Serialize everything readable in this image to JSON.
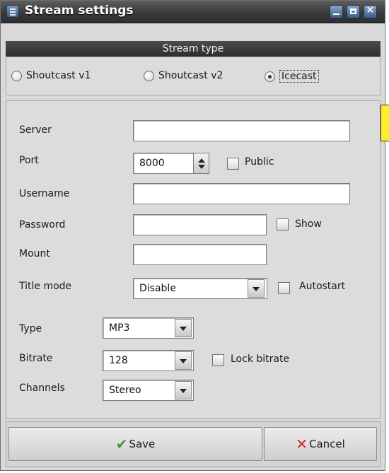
{
  "window": {
    "title": "Stream settings"
  },
  "stream_type": {
    "header": "Stream type",
    "options": [
      {
        "label": "Shoutcast v1",
        "selected": false
      },
      {
        "label": "Shoutcast v2",
        "selected": false
      },
      {
        "label": "Icecast",
        "selected": true
      }
    ]
  },
  "form": {
    "server": {
      "label": "Server",
      "value": ""
    },
    "port": {
      "label": "Port",
      "value": "8000",
      "public_label": "Public",
      "public_checked": false
    },
    "username": {
      "label": "Username",
      "value": ""
    },
    "password": {
      "label": "Password",
      "value": "",
      "show_label": "Show",
      "show_checked": false
    },
    "mount": {
      "label": "Mount",
      "value": ""
    },
    "title_mode": {
      "label": "Title mode",
      "value": "Disable",
      "autostart_label": "Autostart",
      "autostart_checked": false
    },
    "type": {
      "label": "Type",
      "value": "MP3"
    },
    "bitrate": {
      "label": "Bitrate",
      "value": "128",
      "lock_label": "Lock bitrate",
      "lock_checked": false
    },
    "channels": {
      "label": "Channels",
      "value": "Stereo"
    }
  },
  "buttons": {
    "save": "Save",
    "cancel": "Cancel"
  },
  "icons": {
    "app": "window-menu-icon",
    "minimize": "minimize-icon",
    "maximize": "maximize-icon",
    "close": "close-icon",
    "save": "checkmark-icon",
    "cancel": "cross-icon"
  },
  "colors": {
    "titlebar": "#3a3a3a",
    "save_icon": "#3d9a2d",
    "cancel_icon": "#d12020",
    "dialog_bg": "#d9d9d9"
  }
}
